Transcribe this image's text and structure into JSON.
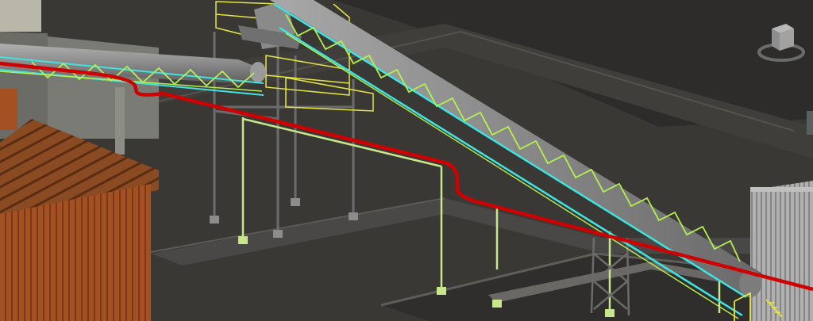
{
  "viewport": {
    "colors": {
      "ground": "#3a3835",
      "far_ground": "#2f2d2b",
      "slab": "#4a4846",
      "concrete": "#8c8d85",
      "pipe": "#8a8a8a",
      "pipe_dark": "#6e6e6e",
      "truss_cyan": "#41e3e0",
      "truss_green": "#b4f050",
      "red_pipe": "#d00000",
      "pipe_support": "#c8e68c",
      "tower_frame": "#e6e641",
      "brick": "#a45023",
      "brick_dark": "#7a3a18",
      "metal_wall": "#a5a5a5"
    },
    "icons": {
      "viewcube": "viewcube-icon",
      "compass": "compass-ring-icon"
    }
  }
}
